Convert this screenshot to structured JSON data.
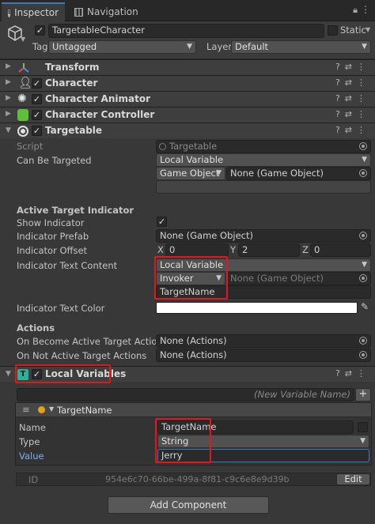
{
  "tabs": {
    "inspector": "Inspector",
    "navigation": "Navigation"
  },
  "object": {
    "name": "TargetableCharacter",
    "static_label": "Static",
    "tag_label": "Tag",
    "tag_value": "Untagged",
    "layer_label": "Layer",
    "layer_value": "Default"
  },
  "components": [
    {
      "name": "Transform"
    },
    {
      "name": "Character"
    },
    {
      "name": "Character Animator"
    },
    {
      "name": "Character Controller"
    },
    {
      "name": "Targetable"
    }
  ],
  "targetable": {
    "script_label": "Script",
    "script_value": "Targetable",
    "can_be_targeted_label": "Can Be Targeted",
    "can_be_targeted_value": "Local Variable",
    "go_dropdown": "Game Object",
    "go_value": "None (Game Object)",
    "section_indicator": "Active Target Indicator",
    "show_indicator_label": "Show Indicator",
    "indicator_prefab_label": "Indicator Prefab",
    "indicator_prefab_value": "None (Game Object)",
    "indicator_offset_label": "Indicator Offset",
    "offset": {
      "x_label": "X",
      "x": "0",
      "y_label": "Y",
      "y": "2",
      "z_label": "Z",
      "z": "0"
    },
    "text_content_label": "Indicator Text Content",
    "text_content_value": "Local Variable",
    "invoker_value": "Invoker",
    "invoker_go_value": "None (Game Object)",
    "target_name_value": "TargetName",
    "text_color_label": "Indicator Text Color",
    "actions_label": "Actions",
    "on_become_label": "On Become Active Target Actions",
    "on_become_value": "None (Actions)",
    "on_not_label": "On Not Active Target Actions",
    "on_not_value": "None (Actions)"
  },
  "local_variables": {
    "title": "Local Variables",
    "new_variable_placeholder": "(New Variable Name)",
    "add": "+",
    "var_title": "TargetName",
    "name_label": "Name",
    "name_value": "TargetName",
    "type_label": "Type",
    "type_value": "String",
    "value_label": "Value",
    "value_value": "Jerry",
    "id_label": "ID",
    "id_value": "954e6c70-66be-499a-8f81-c9c6e8e9d39b",
    "edit": "Edit"
  },
  "add_component": "Add Component",
  "colors": {
    "highlight": "#e2161b",
    "accent": "#3a79bb"
  }
}
